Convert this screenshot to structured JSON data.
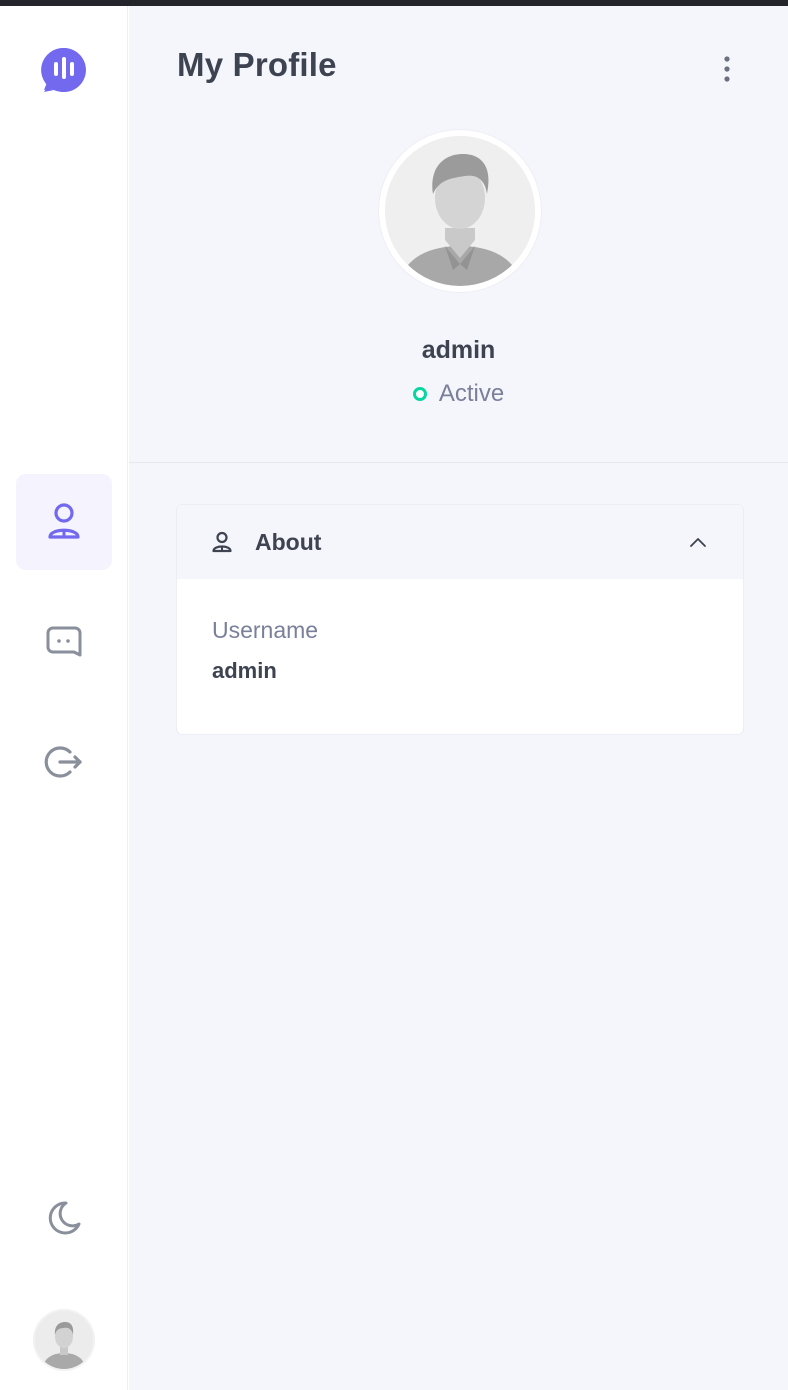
{
  "page": {
    "title": "My Profile"
  },
  "sidebar": {
    "items": [
      {
        "name": "profile",
        "icon": "user-icon",
        "active": true
      },
      {
        "name": "chats",
        "icon": "chat-icon",
        "active": false
      },
      {
        "name": "logout",
        "icon": "logout-icon",
        "active": false
      },
      {
        "name": "theme",
        "icon": "moon-icon",
        "active": false
      }
    ]
  },
  "profile": {
    "name": "admin",
    "status": "Active"
  },
  "about": {
    "title": "About",
    "fields": [
      {
        "label": "Username",
        "value": "admin"
      }
    ]
  },
  "colors": {
    "accent": "#7269ef",
    "status_active": "#06d6a0",
    "text_dark": "#3d4350",
    "text_muted": "#7a7f9a"
  }
}
